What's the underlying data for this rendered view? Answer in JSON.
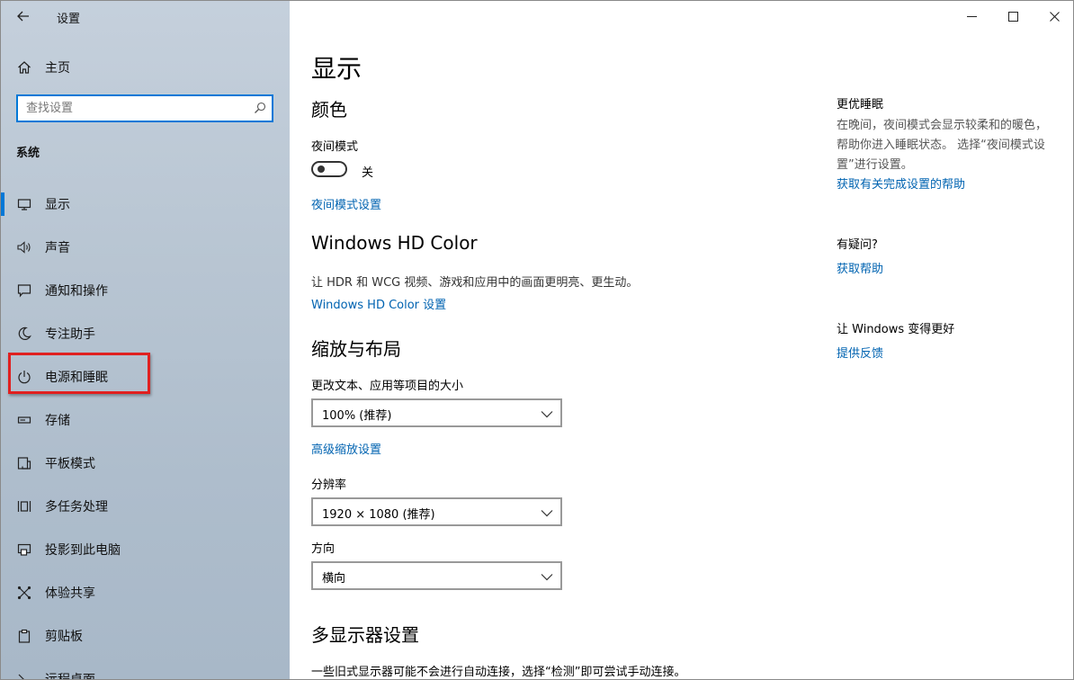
{
  "window": {
    "title": "设置",
    "controls": [
      "minimize",
      "maximize",
      "close"
    ]
  },
  "sidebar": {
    "home_label": "主页",
    "search_placeholder": "查找设置",
    "section_title": "系统",
    "items": [
      {
        "label": "显示",
        "icon": "monitor-icon",
        "active": true
      },
      {
        "label": "声音",
        "icon": "speaker-icon"
      },
      {
        "label": "通知和操作",
        "icon": "notification-icon"
      },
      {
        "label": "专注助手",
        "icon": "moon-icon"
      },
      {
        "label": "电源和睡眠",
        "icon": "power-icon",
        "highlighted": true
      },
      {
        "label": "存储",
        "icon": "storage-icon"
      },
      {
        "label": "平板模式",
        "icon": "tablet-icon"
      },
      {
        "label": "多任务处理",
        "icon": "multitask-icon"
      },
      {
        "label": "投影到此电脑",
        "icon": "project-icon"
      },
      {
        "label": "体验共享",
        "icon": "share-icon"
      },
      {
        "label": "剪贴板",
        "icon": "clipboard-icon"
      },
      {
        "label": "远程桌面",
        "icon": "remote-desktop-icon"
      }
    ]
  },
  "main": {
    "page_title": "显示",
    "color": {
      "heading": "颜色",
      "night_light_label": "夜间模式",
      "toggle_state": "关",
      "settings_link": "夜间模式设置"
    },
    "hdr": {
      "heading": "Windows HD Color",
      "description": "让 HDR 和 WCG 视频、游戏和应用中的画面更明亮、更生动。",
      "settings_link": "Windows HD Color 设置"
    },
    "scale": {
      "heading": "缩放与布局",
      "size_label": "更改文本、应用等项目的大小",
      "size_value": "100% (推荐)",
      "advanced_link": "高级缩放设置",
      "resolution_label": "分辨率",
      "resolution_value": "1920 × 1080 (推荐)",
      "orientation_label": "方向",
      "orientation_value": "横向"
    },
    "multi": {
      "heading": "多显示器设置",
      "description": "一些旧式显示器可能不会进行自动连接，选择“检测”即可尝试手动连接。"
    }
  },
  "right": {
    "sleep": {
      "heading": "更优睡眠",
      "description": "在晚间，夜间模式会显示较柔和的暖色，帮助你进入睡眠状态。 选择“夜间模式设置”进行设置。",
      "link": "获取有关完成设置的帮助"
    },
    "question": {
      "heading": "有疑问?",
      "link": "获取帮助"
    },
    "improve": {
      "heading": "让 Windows 变得更好",
      "link": "提供反馈"
    }
  },
  "colors": {
    "accent": "#0078d7",
    "link": "#0063b1",
    "highlight": "#e02020"
  }
}
